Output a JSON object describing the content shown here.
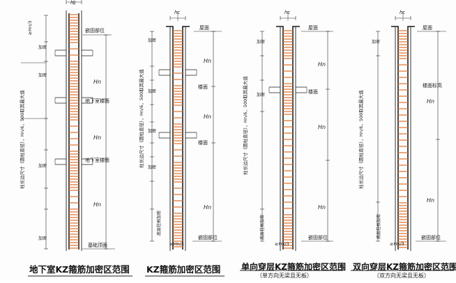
{
  "title": "",
  "palette": {
    "line": "#2a2a2a",
    "stirrup": "#e07a3a",
    "bar": "#1a1a1a",
    "rule": "#333333"
  },
  "panels": [
    {
      "caption": "地下室KZ箍筋加密区范围",
      "subcaption": "",
      "labels": {
        "hc": "hc",
        "hn3": "≥Hn/3",
        "embed": "嵌固部位",
        "basement_floor": "地下室楼面",
        "basement_floor2": "地下室楼面",
        "foundation_top": "基础顶面",
        "hn_labels": [
          "Hn",
          "Hn",
          "Hn"
        ],
        "dense_tag": "加密",
        "rule_text": "柱长边尺寸（圆柱直径），Hn/6，500取其最大值"
      }
    },
    {
      "caption": "KZ箍筋加密区范围",
      "subcaption": "",
      "labels": {
        "hc": "hc",
        "roof": "屋面",
        "floors": [
          "楼面",
          "楼面"
        ],
        "embed": "嵌固部位",
        "bottom_tag": "底层柱根加密",
        "hn3": "≥Hn/3",
        "hn_labels": [
          "Hn",
          "Hn",
          "Hn"
        ],
        "dense_tag": "加密",
        "rule_text": "柱长边尺寸（圆柱直径），Hn/6，500取其最大值"
      }
    },
    {
      "caption": "单向穿层KZ箍筋加密区范围",
      "subcaption": "（单方向无梁且无板）",
      "labels": {
        "hc": "hc",
        "roof": "屋面",
        "floors": [
          "楼面"
        ],
        "embed": "嵌固部位",
        "bottom_tag": "底层柱根加密",
        "hn3": "≥Hn/3",
        "hn_labels": [
          "Hn",
          "Hn",
          "Hn"
        ],
        "dense_tag": "加密",
        "rule_text": "柱长边尺寸（圆柱直径），Hn/6，500取其最大值"
      }
    },
    {
      "caption": "双向穿层KZ箍筋加密区范围",
      "subcaption": "（双方向无梁且无板）",
      "labels": {
        "hc": "hc",
        "roof": "屋面",
        "floor_mark": "楼面标高",
        "embed": "嵌固部位",
        "bottom_tag": "底层柱根加密",
        "hn3": "≥Hn/3",
        "hn_labels": [
          "Hn",
          "Hn"
        ],
        "dense_tag": "加密",
        "rule_text": "柱长边尺寸（圆柱直径），Hn/6，500取其最大值"
      }
    }
  ]
}
